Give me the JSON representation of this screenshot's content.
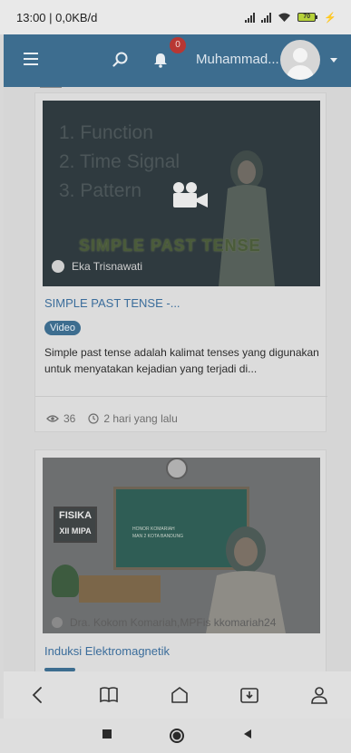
{
  "status_bar": {
    "left_text": "13:00 | 0,0KB/d",
    "battery_level": "70"
  },
  "app_bar": {
    "notification_count": "0",
    "user_name": "Muhammad..."
  },
  "cards": [
    {
      "thumbnail_lines": [
        "1. Function",
        "2. Time Signal",
        "3. Pattern"
      ],
      "thumbnail_headline": "SIMPLE PAST TENSE",
      "author": "Eka Trisnawati",
      "title": "SIMPLE PAST TENSE -...",
      "tag": "Video",
      "description": "Simple past tense adalah kalimat tenses yang digunakan untuk menyatakan kejadian yang terjadi di...",
      "views": "36",
      "time_ago": "2 hari yang lalu"
    },
    {
      "thumbnail_badge_line1": "FISIKA",
      "thumbnail_badge_line2": "XII MIPA",
      "board_line1": "HONOR KOMARIAH",
      "board_line2": "MAN 2 KOTA BANDUNG",
      "author_caption": "Dra. Kokom Komariah,MPFis kkomariah24",
      "title": "Induksi Elektromagnetik"
    }
  ],
  "colors": {
    "app_bar": "#3d6d8f",
    "accent_link": "#3b6d9b",
    "badge_red": "#b83733"
  },
  "icons": {
    "menu": "hamburger-icon",
    "search": "search-icon",
    "notifications": "bell-icon",
    "video": "video-camera-icon",
    "views": "eye-icon",
    "time": "clock-icon",
    "nav_back": "chevron-left-icon",
    "nav_courses": "book-icon",
    "nav_home": "home-icon",
    "nav_downloads": "download-folder-icon",
    "nav_profile": "person-icon"
  }
}
